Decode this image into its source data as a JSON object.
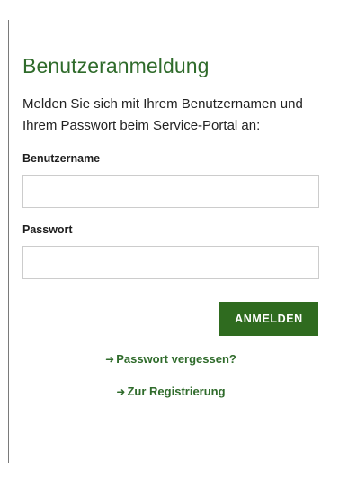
{
  "login": {
    "title": "Benutzeranmeldung",
    "intro": "Melden Sie sich mit Ihrem Benutzernamen und Ihrem Passwort beim Service-Portal an:",
    "username_label": "Benutzername",
    "username_value": "",
    "password_label": "Passwort",
    "password_value": "",
    "submit_label": "ANMELDEN"
  },
  "links": {
    "forgot_password": "Passwort vergessen?",
    "register": "Zur Registrierung"
  },
  "icons": {
    "link_arrow": "arrow-right-icon"
  },
  "colors": {
    "accent_green": "#2f6b2b",
    "button_green": "#2f6b1f",
    "input_border": "#cccccc",
    "text": "#222222"
  }
}
